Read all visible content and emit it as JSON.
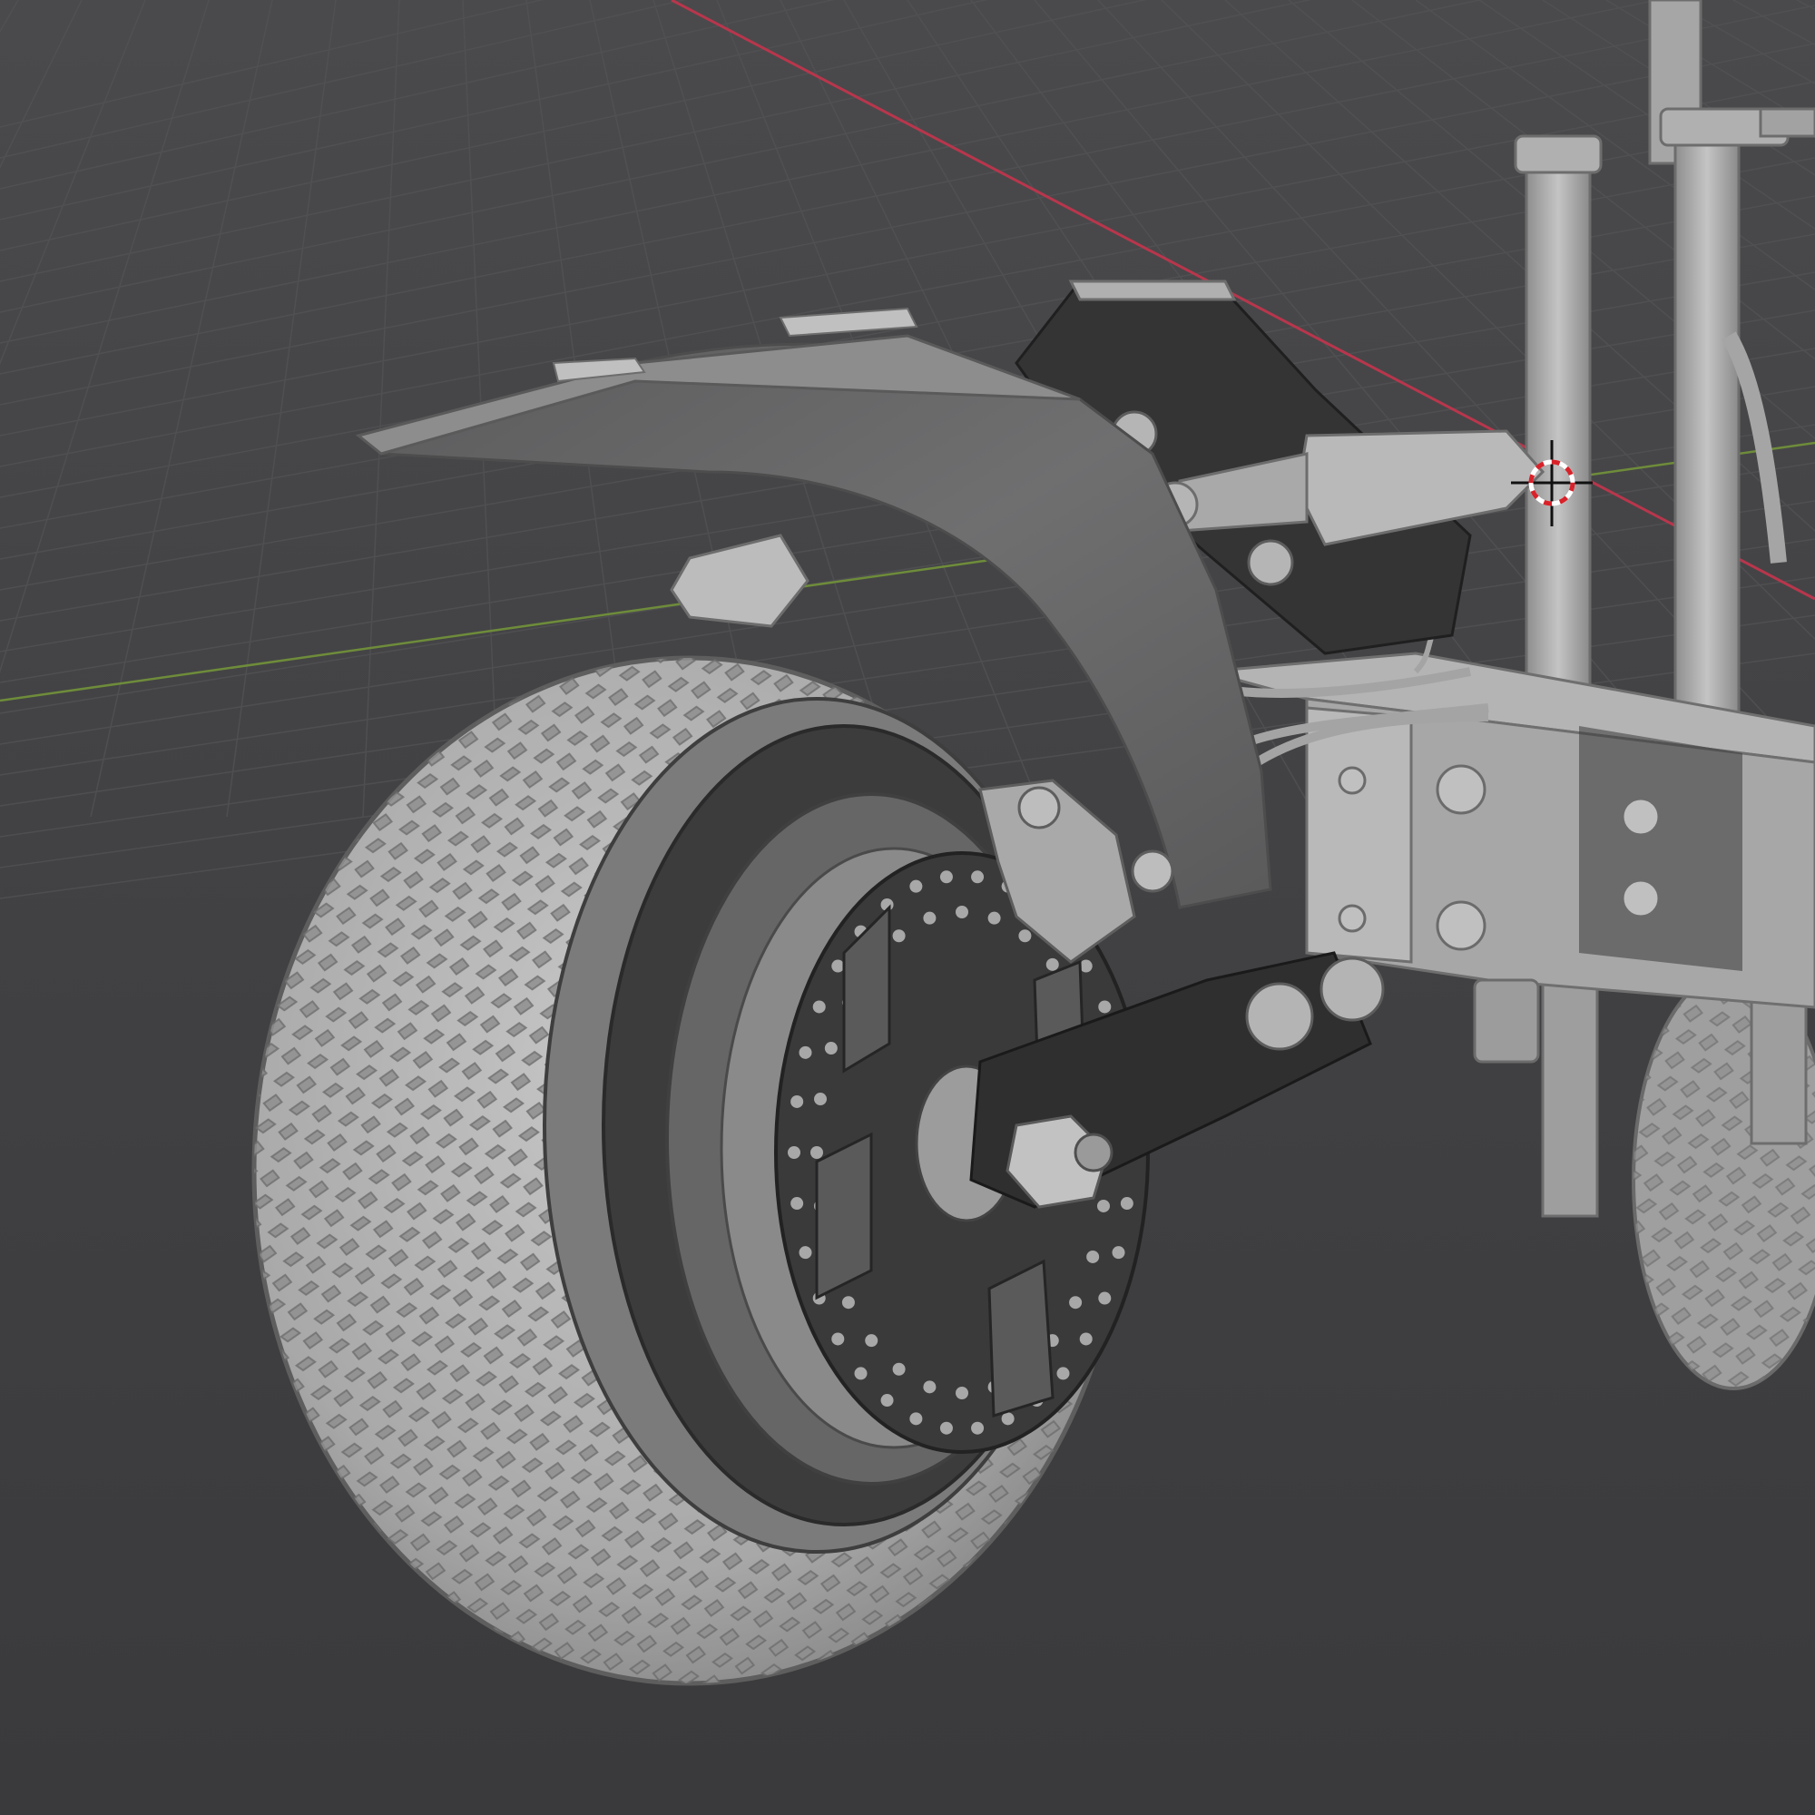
{
  "app": {
    "name": "3D viewport"
  },
  "viewport": {
    "shading": "solid",
    "background_color": "#3d3d3f",
    "grid_color": "#4a4a4c",
    "x_axis_color": "#b8364c",
    "y_axis_color": "#6e8c3a",
    "model_color": "#a9a9a9",
    "model_dark_color": "#2e2e2f",
    "cursor_ring_colors": [
      "#ffffff",
      "#d8222a"
    ]
  },
  "scene": {
    "objects": [
      {
        "name": "rear-tire",
        "icon": "tire"
      },
      {
        "name": "rim",
        "icon": "wheel"
      },
      {
        "name": "brake-disc",
        "icon": "disc"
      },
      {
        "name": "brake-caliper",
        "icon": "caliper"
      },
      {
        "name": "swing-arm",
        "icon": "arm"
      },
      {
        "name": "fender",
        "icon": "fender"
      },
      {
        "name": "license-plate-bracket",
        "icon": "plate"
      },
      {
        "name": "tail-light",
        "icon": "light"
      },
      {
        "name": "turn-signal-left",
        "icon": "light"
      },
      {
        "name": "turn-signal-right",
        "icon": "light"
      },
      {
        "name": "frame-deck",
        "icon": "frame"
      },
      {
        "name": "fork-stem",
        "icon": "stem"
      },
      {
        "name": "front-tire",
        "icon": "tire"
      }
    ]
  }
}
